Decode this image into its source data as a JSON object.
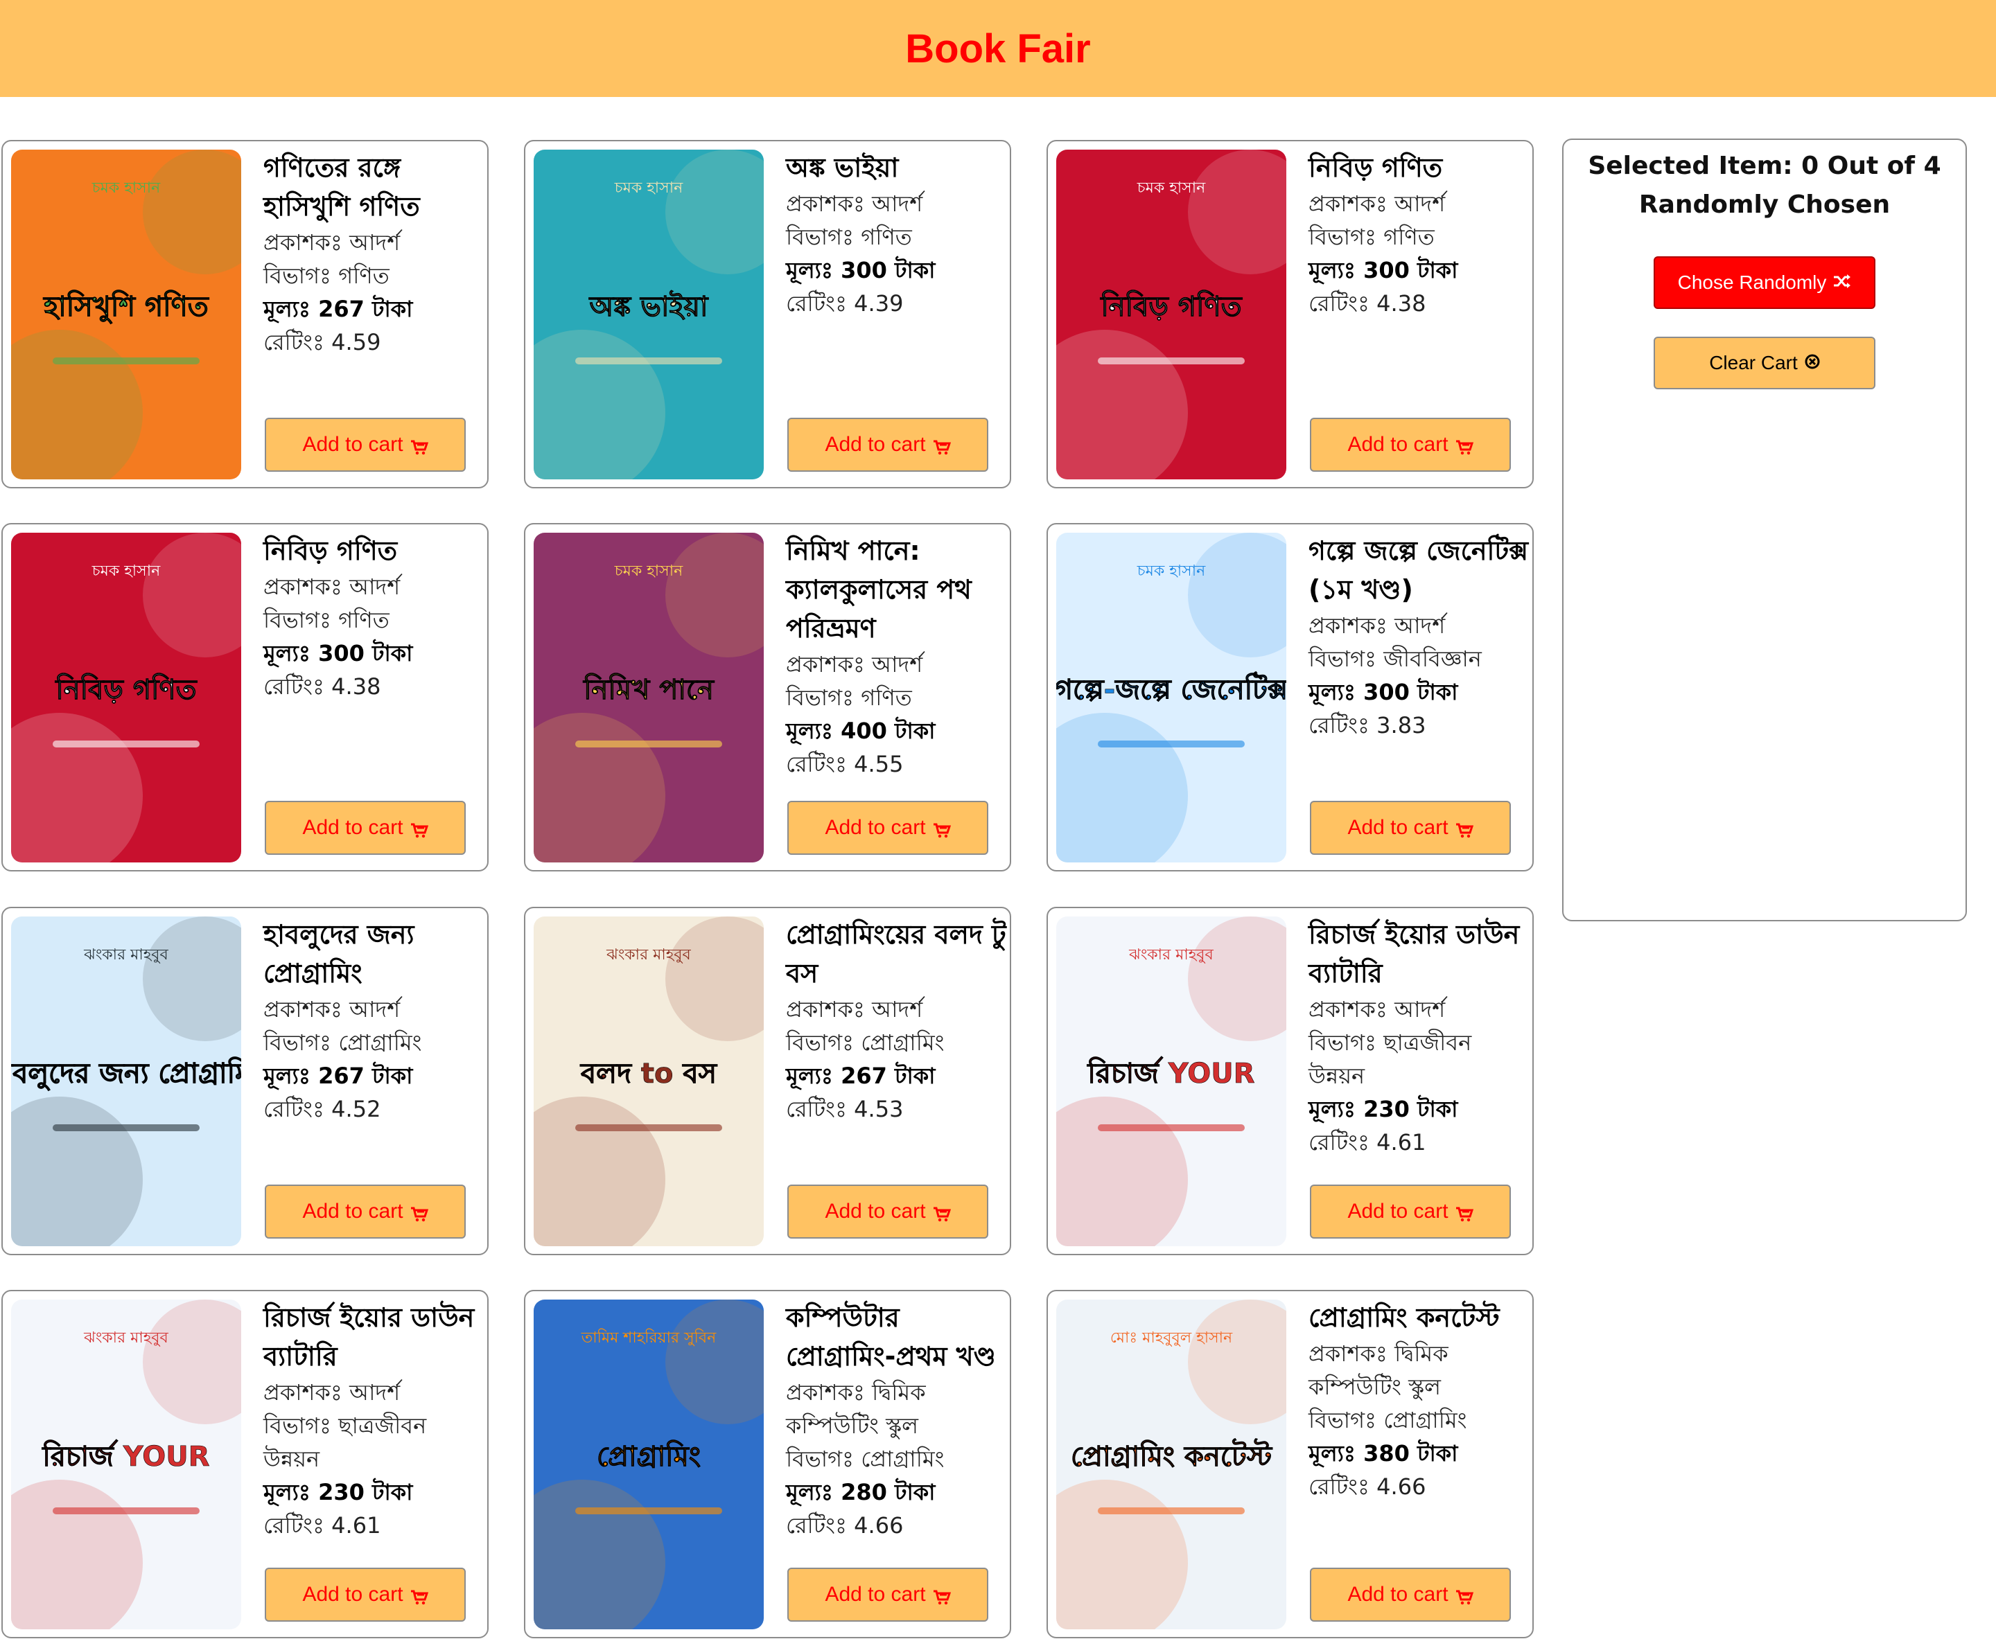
{
  "header": {
    "title": "Book Fair"
  },
  "books": [
    {
      "title": "গণিতের রঙ্গে হাসিখুশি গণিত",
      "publisher": "প্রকাশকঃ আদর্শ",
      "category": "বিভাগঃ গণিত",
      "price": "মূল্যঃ 267 টাকা",
      "rating": "রেটিংঃ 4.59",
      "cart_label": "Add to cart",
      "cover": {
        "bg": "#f47b20",
        "accent": "#4caf50",
        "author": "চমক হাসান",
        "text": "হাসিখুশি গণিত"
      }
    },
    {
      "title": "অঙ্ক ভাইয়া",
      "publisher": "প্রকাশকঃ আদর্শ",
      "category": "বিভাগঃ গণিত",
      "price": "মূল্যঃ 300 টাকা",
      "rating": "রেটিংঃ 4.39",
      "cart_label": "Add to cart",
      "cover": {
        "bg": "#2aa9b8",
        "accent": "#f4e3b1",
        "author": "চমক হাসান",
        "text": "অঙ্ক ভাইয়া"
      }
    },
    {
      "title": "নিবিড় গণিত",
      "publisher": "প্রকাশকঃ আদর্শ",
      "category": "বিভাগঃ গণিত",
      "price": "মূল্যঃ 300 টাকা",
      "rating": "রেটিংঃ 4.38",
      "cart_label": "Add to cart",
      "cover": {
        "bg": "#c8102e",
        "accent": "#ffffff",
        "author": "চমক হাসান",
        "text": "নিবিড় গণিত"
      }
    },
    {
      "title": "নিবিড় গণিত",
      "publisher": "প্রকাশকঃ আদর্শ",
      "category": "বিভাগঃ গণিত",
      "price": "মূল্যঃ 300 টাকা",
      "rating": "রেটিংঃ 4.38",
      "cart_label": "Add to cart",
      "cover": {
        "bg": "#c8102e",
        "accent": "#ffffff",
        "author": "চমক হাসান",
        "text": "নিবিড় গণিত"
      }
    },
    {
      "title": "নিমিখ পানে: ক্যালকুলাসের পথ পরিভ্রমণ",
      "publisher": "প্রকাশকঃ আদর্শ",
      "category": "বিভাগঃ গণিত",
      "price": "মূল্যঃ 400 টাকা",
      "rating": "রেটিংঃ 4.55",
      "cart_label": "Add to cart",
      "cover": {
        "bg": "#8e3468",
        "accent": "#ffd54f",
        "author": "চমক হাসান",
        "text": "নিমিখ পানে"
      }
    },
    {
      "title": "গল্পে জল্পে জেনেটিক্স (১ম খণ্ড)",
      "publisher": "প্রকাশকঃ আদর্শ",
      "category": "বিভাগঃ জীববিজ্ঞান",
      "price": "মূল্যঃ 300 টাকা",
      "rating": "রেটিংঃ 3.83",
      "cart_label": "Add to cart",
      "cover": {
        "bg": "#dcefff",
        "accent": "#1e88e5",
        "author": "চমক হাসান",
        "text": "গল্পে-জল্পে জেনেটিক্স"
      }
    },
    {
      "title": "হাবলুদের জন্য প্রোগ্রামিং",
      "publisher": "প্রকাশকঃ আদর্শ",
      "category": "বিভাগঃ প্রোগ্রামিং",
      "price": "মূল্যঃ 267 টাকা",
      "rating": "রেটিংঃ 4.52",
      "cart_label": "Add to cart",
      "cover": {
        "bg": "#d6ebfa",
        "accent": "#263238",
        "author": "ঝংকার মাহবুব",
        "text": "হাবলুদের জন্য প্রোগ্রামিং"
      }
    },
    {
      "title": "প্রোগ্রামিংয়ের বলদ টু বস",
      "publisher": "প্রকাশকঃ আদর্শ",
      "category": "বিভাগঃ প্রোগ্রামিং",
      "price": "মূল্যঃ 267 টাকা",
      "rating": "রেটিংঃ 4.53",
      "cart_label": "Add to cart",
      "cover": {
        "bg": "#f4ecdc",
        "accent": "#8b2e1e",
        "author": "ঝংকার মাহবুব",
        "text": "বলদ to বস"
      }
    },
    {
      "title": "রিচার্জ ইয়োর ডাউন ব্যাটারি",
      "publisher": "প্রকাশকঃ আদর্শ",
      "category": "বিভাগঃ ছাত্রজীবন উন্নয়ন",
      "price": "মূল্যঃ 230 টাকা",
      "rating": "রেটিংঃ 4.61",
      "cart_label": "Add to cart",
      "cover": {
        "bg": "#f3f6fb",
        "accent": "#d32f2f",
        "author": "ঝংকার মাহবুব",
        "text": "রিচার্জ YOUR"
      }
    },
    {
      "title": "রিচার্জ ইয়োর ডাউন ব্যাটারি",
      "publisher": "প্রকাশকঃ আদর্শ",
      "category": "বিভাগঃ ছাত্রজীবন উন্নয়ন",
      "price": "মূল্যঃ 230 টাকা",
      "rating": "রেটিংঃ 4.61",
      "cart_label": "Add to cart",
      "cover": {
        "bg": "#f3f6fb",
        "accent": "#d32f2f",
        "author": "ঝংকার মাহবুব",
        "text": "রিচার্জ YOUR"
      }
    },
    {
      "title": "কম্পিউটার প্রোগ্রামিং-প্রথম খণ্ড",
      "publisher": "প্রকাশকঃ দ্বিমিক কম্পিউটিং স্কুল",
      "category": "বিভাগঃ প্রোগ্রামিং",
      "price": "মূল্যঃ 280 টাকা",
      "rating": "রেটিংঃ 4.66",
      "cart_label": "Add to cart",
      "cover": {
        "bg": "#2f6fc9",
        "accent": "#ff8f00",
        "author": "তামিম শাহরিয়ার সুবিন",
        "text": "প্রোগ্রামিং"
      }
    },
    {
      "title": "প্রোগ্রামিং কনটেস্ট",
      "publisher": "প্রকাশকঃ দ্বিমিক কম্পিউটিং স্কুল",
      "category": "বিভাগঃ প্রোগ্রামিং",
      "price": "মূল্যঃ 380 টাকা",
      "rating": "রেটিংঃ 4.66",
      "cart_label": "Add to cart",
      "cover": {
        "bg": "#eef3f8",
        "accent": "#f26522",
        "author": "মোঃ মাহবুবুল হাসান",
        "text": "প্রোগ্রামিং কনটেস্ট"
      }
    }
  ],
  "sidebar": {
    "selected_text": "Selected Item: 0 Out of 4",
    "random_heading": "Randomly Chosen",
    "random_button": "Chose Randomly",
    "clear_button": "Clear Cart"
  }
}
